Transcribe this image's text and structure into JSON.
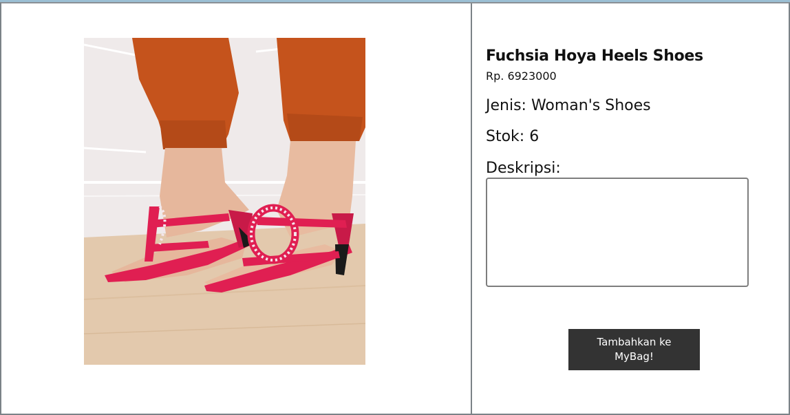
{
  "product": {
    "title": "Fuchsia Hoya Heels Shoes",
    "price": "Rp. 6923000",
    "type_label": "Jenis:",
    "type_value": "Woman's Shoes",
    "stock_label": "Stok:",
    "stock_value": "6",
    "description_label": "Deskripsi:",
    "description_value": "",
    "image_alt": "product photo"
  },
  "actions": {
    "add_to_bag_label": "Tambahkan ke MyBag!"
  },
  "colors": {
    "button_bg": "#333333",
    "button_text": "#ffffff",
    "border": "#7b8287",
    "shoe": "#e01f52"
  }
}
